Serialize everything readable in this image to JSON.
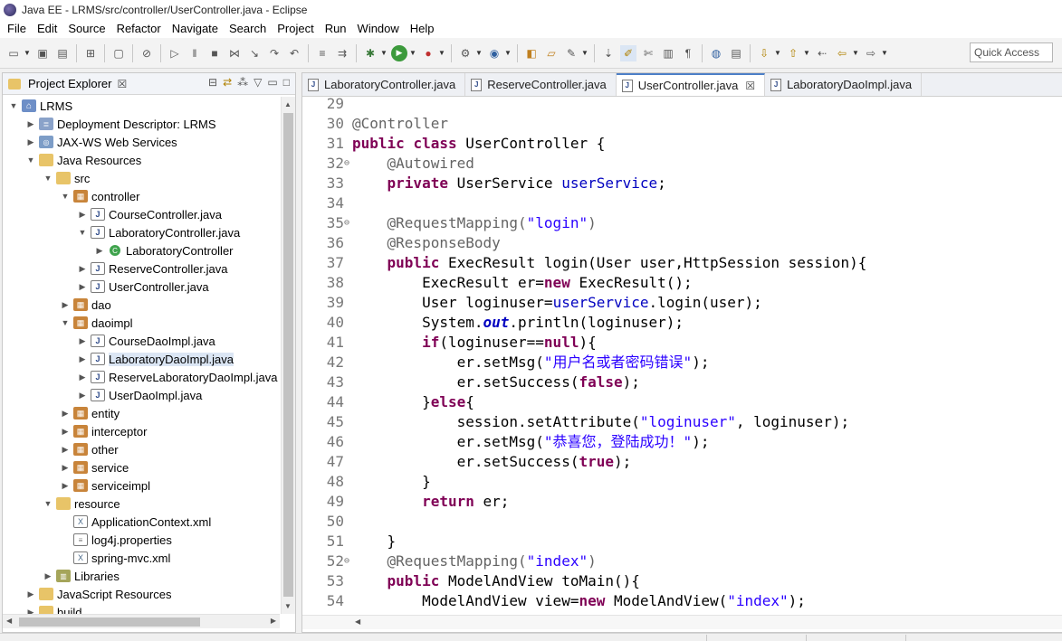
{
  "window": {
    "title": "Java EE - LRMS/src/controller/UserController.java - Eclipse"
  },
  "menu": [
    "File",
    "Edit",
    "Source",
    "Refactor",
    "Navigate",
    "Search",
    "Project",
    "Run",
    "Window",
    "Help"
  ],
  "toolbar": {
    "quick_access_placeholder": "Quick Access"
  },
  "explorer": {
    "title": "Project Explorer",
    "close_glyph": "☒",
    "tree": [
      {
        "label": "LRMS",
        "depth": 0,
        "state": "open",
        "icon": "project-icon"
      },
      {
        "label": "Deployment Descriptor: LRMS",
        "depth": 1,
        "state": "closed",
        "icon": "deployment-descriptor-icon"
      },
      {
        "label": "JAX-WS Web Services",
        "depth": 1,
        "state": "closed",
        "icon": "web-services-icon"
      },
      {
        "label": "Java Resources",
        "depth": 1,
        "state": "open",
        "icon": "java-resources-icon"
      },
      {
        "label": "src",
        "depth": 2,
        "state": "open",
        "icon": "source-folder-icon"
      },
      {
        "label": "controller",
        "depth": 3,
        "state": "open",
        "icon": "package-icon"
      },
      {
        "label": "CourseController.java",
        "depth": 4,
        "state": "closed",
        "icon": "java-file-icon"
      },
      {
        "label": "LaboratoryController.java",
        "depth": 4,
        "state": "open",
        "icon": "java-file-icon"
      },
      {
        "label": "LaboratoryController",
        "depth": 5,
        "state": "closed",
        "icon": "class-icon"
      },
      {
        "label": "ReserveController.java",
        "depth": 4,
        "state": "closed",
        "icon": "java-file-icon"
      },
      {
        "label": "UserController.java",
        "depth": 4,
        "state": "closed",
        "icon": "java-file-icon"
      },
      {
        "label": "dao",
        "depth": 3,
        "state": "closed",
        "icon": "package-icon"
      },
      {
        "label": "daoimpl",
        "depth": 3,
        "state": "open",
        "icon": "package-icon"
      },
      {
        "label": "CourseDaoImpl.java",
        "depth": 4,
        "state": "closed",
        "icon": "java-file-icon"
      },
      {
        "label": "LaboratoryDaoImpl.java",
        "depth": 4,
        "state": "closed",
        "icon": "java-file-icon",
        "selected": true
      },
      {
        "label": "ReserveLaboratoryDaoImpl.java",
        "depth": 4,
        "state": "closed",
        "icon": "java-file-icon"
      },
      {
        "label": "UserDaoImpl.java",
        "depth": 4,
        "state": "closed",
        "icon": "java-file-icon"
      },
      {
        "label": "entity",
        "depth": 3,
        "state": "closed",
        "icon": "package-icon"
      },
      {
        "label": "interceptor",
        "depth": 3,
        "state": "closed",
        "icon": "package-icon"
      },
      {
        "label": "other",
        "depth": 3,
        "state": "closed",
        "icon": "package-icon"
      },
      {
        "label": "service",
        "depth": 3,
        "state": "closed",
        "icon": "package-icon"
      },
      {
        "label": "serviceimpl",
        "depth": 3,
        "state": "closed",
        "icon": "package-icon"
      },
      {
        "label": "resource",
        "depth": 2,
        "state": "open",
        "icon": "source-folder-icon"
      },
      {
        "label": "ApplicationContext.xml",
        "depth": 3,
        "state": "none",
        "icon": "xml-file-icon"
      },
      {
        "label": "log4j.properties",
        "depth": 3,
        "state": "none",
        "icon": "properties-file-icon"
      },
      {
        "label": "spring-mvc.xml",
        "depth": 3,
        "state": "none",
        "icon": "xml-file-icon"
      },
      {
        "label": "Libraries",
        "depth": 2,
        "state": "closed",
        "icon": "libraries-icon"
      },
      {
        "label": "JavaScript Resources",
        "depth": 1,
        "state": "closed",
        "icon": "javascript-resources-icon"
      },
      {
        "label": "build",
        "depth": 1,
        "state": "closed",
        "icon": "folder-icon"
      }
    ]
  },
  "editor": {
    "tabs": [
      {
        "label": "LaboratoryController.java",
        "active": false
      },
      {
        "label": "ReserveController.java",
        "active": false
      },
      {
        "label": "UserController.java",
        "active": true,
        "close": "☒"
      },
      {
        "label": "LaboratoryDaoImpl.java",
        "active": false
      }
    ],
    "lines": [
      {
        "n": "29",
        "fold": "",
        "tokens": []
      },
      {
        "n": "30",
        "fold": "",
        "tokens": [
          [
            "ann",
            "@Controller"
          ]
        ]
      },
      {
        "n": "31",
        "fold": "",
        "tokens": [
          [
            "kw",
            "public"
          ],
          [
            "p",
            " "
          ],
          [
            "kw",
            "class"
          ],
          [
            "p",
            " UserController {"
          ]
        ]
      },
      {
        "n": "32",
        "fold": "⊖",
        "tokens": [
          [
            "p",
            "    "
          ],
          [
            "ann",
            "@Autowired"
          ]
        ]
      },
      {
        "n": "33",
        "fold": "",
        "tokens": [
          [
            "p",
            "    "
          ],
          [
            "kw",
            "private"
          ],
          [
            "p",
            " UserService "
          ],
          [
            "fld",
            "userService"
          ],
          [
            "p",
            ";"
          ]
        ]
      },
      {
        "n": "34",
        "fold": "",
        "tokens": []
      },
      {
        "n": "35",
        "fold": "⊖",
        "tokens": [
          [
            "p",
            "    "
          ],
          [
            "ann",
            "@RequestMapping("
          ],
          [
            "str",
            "\"login\""
          ],
          [
            "ann",
            ")"
          ]
        ]
      },
      {
        "n": "36",
        "fold": "",
        "tokens": [
          [
            "p",
            "    "
          ],
          [
            "ann",
            "@ResponseBody"
          ]
        ]
      },
      {
        "n": "37",
        "fold": "",
        "tokens": [
          [
            "p",
            "    "
          ],
          [
            "kw",
            "public"
          ],
          [
            "p",
            " ExecResult login(User user,HttpSession session){"
          ]
        ]
      },
      {
        "n": "38",
        "fold": "",
        "tokens": [
          [
            "p",
            "        ExecResult er="
          ],
          [
            "kw",
            "new"
          ],
          [
            "p",
            " ExecResult();"
          ]
        ]
      },
      {
        "n": "39",
        "fold": "",
        "tokens": [
          [
            "p",
            "        User loginuser="
          ],
          [
            "fld",
            "userService"
          ],
          [
            "p",
            ".login(user);"
          ]
        ]
      },
      {
        "n": "40",
        "fold": "",
        "tokens": [
          [
            "p",
            "        System."
          ],
          [
            "sfld",
            "out"
          ],
          [
            "p",
            ".println(loginuser);"
          ]
        ]
      },
      {
        "n": "41",
        "fold": "",
        "tokens": [
          [
            "p",
            "        "
          ],
          [
            "kw",
            "if"
          ],
          [
            "p",
            "(loginuser=="
          ],
          [
            "kw",
            "null"
          ],
          [
            "p",
            "){"
          ]
        ]
      },
      {
        "n": "42",
        "fold": "",
        "tokens": [
          [
            "p",
            "            er.setMsg("
          ],
          [
            "str",
            "\"用户名或者密码错误\""
          ],
          [
            "p",
            ");"
          ]
        ]
      },
      {
        "n": "43",
        "fold": "",
        "tokens": [
          [
            "p",
            "            er.setSuccess("
          ],
          [
            "kw",
            "false"
          ],
          [
            "p",
            ");"
          ]
        ]
      },
      {
        "n": "44",
        "fold": "",
        "tokens": [
          [
            "p",
            "        }"
          ],
          [
            "kw",
            "else"
          ],
          [
            "p",
            "{"
          ]
        ]
      },
      {
        "n": "45",
        "fold": "",
        "tokens": [
          [
            "p",
            "            session.setAttribute("
          ],
          [
            "str",
            "\"loginuser\""
          ],
          [
            "p",
            ", loginuser);"
          ]
        ]
      },
      {
        "n": "46",
        "fold": "",
        "tokens": [
          [
            "p",
            "            er.setMsg("
          ],
          [
            "str",
            "\"恭喜您，登陆成功！\""
          ],
          [
            "p",
            ");"
          ]
        ]
      },
      {
        "n": "47",
        "fold": "",
        "tokens": [
          [
            "p",
            "            er.setSuccess("
          ],
          [
            "kw",
            "true"
          ],
          [
            "p",
            ");"
          ]
        ]
      },
      {
        "n": "48",
        "fold": "",
        "tokens": [
          [
            "p",
            "        }"
          ]
        ]
      },
      {
        "n": "49",
        "fold": "",
        "tokens": [
          [
            "p",
            "        "
          ],
          [
            "kw",
            "return"
          ],
          [
            "p",
            " er;"
          ]
        ]
      },
      {
        "n": "50",
        "fold": "",
        "tokens": []
      },
      {
        "n": "51",
        "fold": "",
        "tokens": [
          [
            "p",
            "    }"
          ]
        ]
      },
      {
        "n": "52",
        "fold": "⊖",
        "tokens": [
          [
            "p",
            "    "
          ],
          [
            "ann",
            "@RequestMapping("
          ],
          [
            "str",
            "\"index\""
          ],
          [
            "ann",
            ")"
          ]
        ]
      },
      {
        "n": "53",
        "fold": "",
        "tokens": [
          [
            "p",
            "    "
          ],
          [
            "kw",
            "public"
          ],
          [
            "p",
            " ModelAndView toMain(){"
          ]
        ]
      },
      {
        "n": "54",
        "fold": "",
        "tokens": [
          [
            "p",
            "        ModelAndView view="
          ],
          [
            "kw",
            "new"
          ],
          [
            "p",
            " ModelAndView("
          ],
          [
            "str",
            "\"index\""
          ],
          [
            "p",
            ");"
          ]
        ]
      }
    ]
  },
  "colors": {
    "keyword": "#7f0055",
    "annotation": "#646464",
    "string": "#2a00ff",
    "field": "#0000c0",
    "line_number": "#787878",
    "active_tab_accent": "#4d7fc7",
    "selection": "#dbe6f4"
  }
}
